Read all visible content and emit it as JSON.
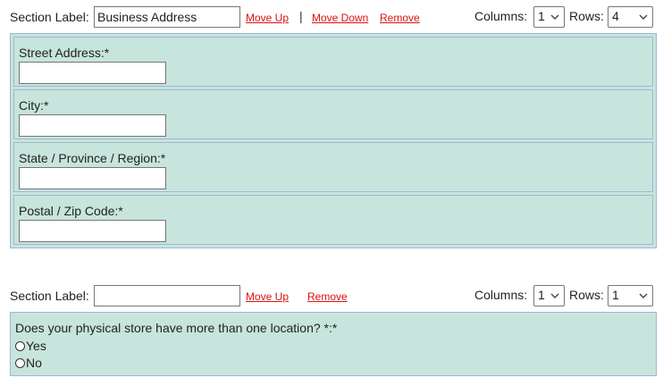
{
  "sections": [
    {
      "section_label_text": "Section Label:",
      "section_label_value": "Business Address",
      "move_up": "Move Up",
      "separator": "|",
      "move_down": "Move Down",
      "remove": "Remove",
      "columns_label": "Columns:",
      "columns_value": "1",
      "rows_label": "Rows:",
      "rows_value": "4",
      "fields": [
        {
          "label": "Street Address:*"
        },
        {
          "label": "City:*"
        },
        {
          "label": "State / Province / Region:*"
        },
        {
          "label": "Postal / Zip Code:*"
        }
      ]
    },
    {
      "section_label_text": "Section Label:",
      "section_label_value": "",
      "move_up": "Move Up",
      "remove": "Remove",
      "columns_label": "Columns:",
      "columns_value": "1",
      "rows_label": "Rows:",
      "rows_value": "1",
      "question": {
        "label": "Does your physical store have more than one location? *:*",
        "options": [
          "Yes",
          "No"
        ]
      }
    }
  ]
}
